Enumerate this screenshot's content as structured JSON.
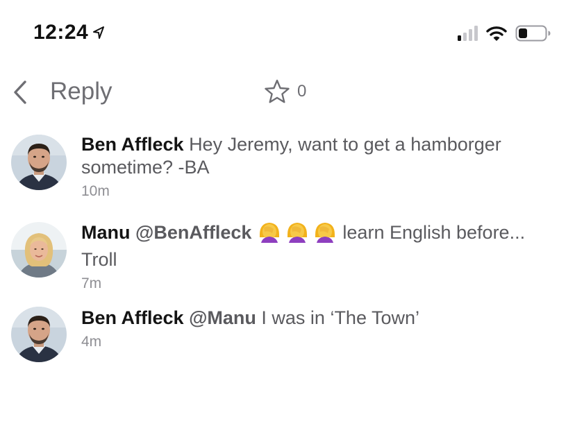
{
  "status_bar": {
    "time": "12:24",
    "icons": [
      "location-arrow-icon",
      "signal-icon",
      "wifi-icon",
      "battery-icon"
    ]
  },
  "nav": {
    "back_icon": "chevron-left-icon",
    "title": "Reply",
    "star_icon": "star-outline-icon",
    "star_count": "0"
  },
  "comments": [
    {
      "author": "Ben Affleck",
      "mention": "",
      "text": "Hey Jeremy, want to get a hamborger sometime? -BA",
      "time": "10m",
      "avatar": "ben-affleck-avatar"
    },
    {
      "author": "Manu",
      "mention": "@BenAffleck",
      "emoji": "🤦‍♀️🤦‍♀️🤦‍♀️",
      "text": "learn English before... Troll",
      "time": "7m",
      "avatar": "manu-avatar"
    },
    {
      "author": "Ben Affleck",
      "mention": "@Manu",
      "text": "I was in ‘The Town’",
      "time": "4m",
      "avatar": "ben-affleck-avatar"
    }
  ],
  "colors": {
    "text_primary": "#141414",
    "text_secondary": "#5a5a5e",
    "text_muted": "#8e8e93",
    "emoji_face": "#f7c948",
    "emoji_hair": "#f2b21c",
    "emoji_shirt": "#8e3fbf"
  }
}
